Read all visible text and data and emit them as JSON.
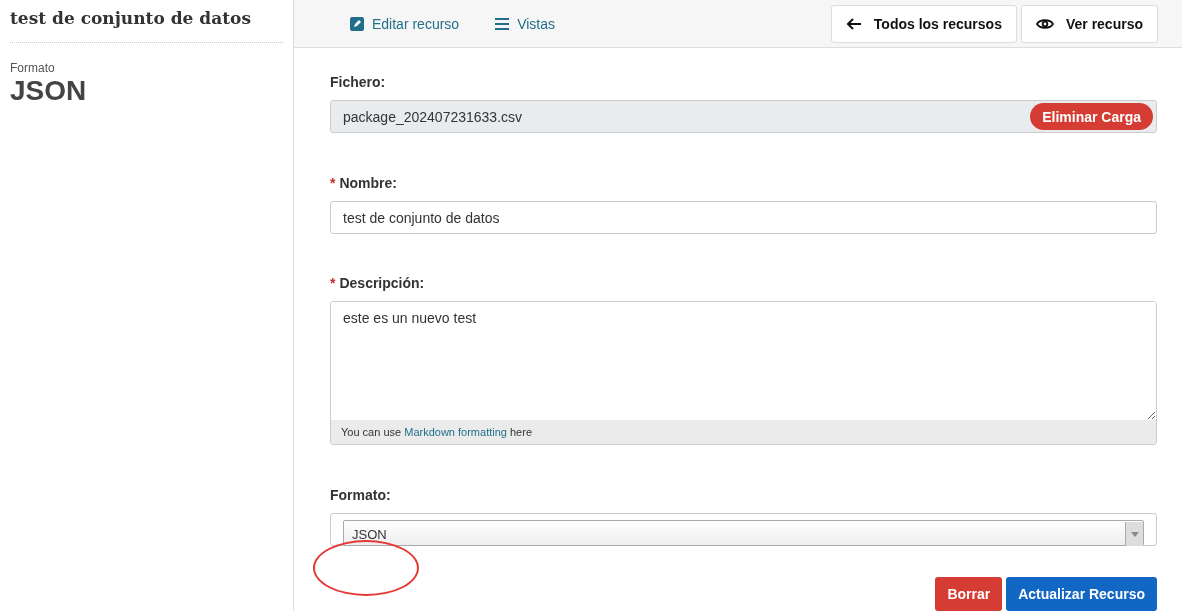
{
  "sidebar": {
    "title": "test de conjunto de datos",
    "format_label": "Formato",
    "format_value": "JSON"
  },
  "toolbar": {
    "tabs": [
      {
        "label": "Editar recurso",
        "kind": "edit"
      },
      {
        "label": "Vistas",
        "kind": "list"
      }
    ],
    "buttons": [
      {
        "label": "Todos los recursos",
        "kind": "arrow"
      },
      {
        "label": "Ver recurso",
        "kind": "eye"
      }
    ]
  },
  "form": {
    "file": {
      "label": "Fichero:",
      "value": "package_202407231633.csv",
      "remove_button": "Eliminar Carga"
    },
    "name": {
      "mark": "*",
      "label": "Nombre:",
      "value": "test de conjunto de datos"
    },
    "description": {
      "mark": "*",
      "label": "Descripción:",
      "value": "este es un nuevo test",
      "hint_before": "You can use",
      "hint_link": "Markdown formatting",
      "hint_after": "here"
    },
    "format": {
      "label": "Formato:",
      "value": "JSON",
      "annotated": true
    }
  },
  "actions": [
    {
      "label": "Borrar",
      "kind": "danger"
    },
    {
      "label": "Actualizar Recurso",
      "kind": "primary"
    }
  ]
}
